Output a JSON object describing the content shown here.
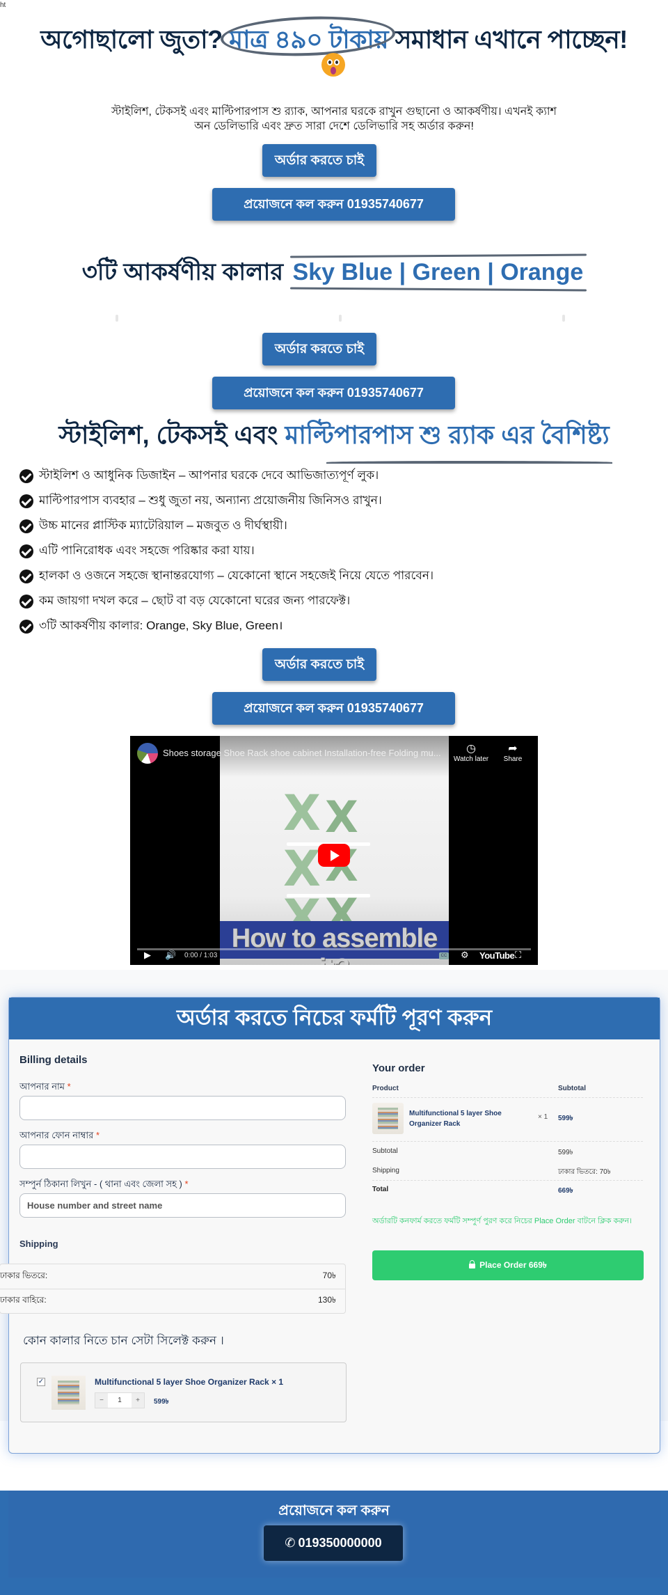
{
  "corner_text": "ht",
  "hero": {
    "title_before": "অগোছালো জুতা?",
    "title_highlight": "মাত্র ৪৯০ টাকায়",
    "title_after": "সমাধান এখানে পাচ্ছেন!",
    "emoji": "astonished-face",
    "lead": "স্টাইলিশ, টেকসই এবং মাল্টিপারপাস শু র‍্যাক, আপনার ঘরকে রাখুন গুছানো ও আকর্ষণীয়। এখনই ক্যাশ অন ডেলিভারি এবং দ্রুত সারা দেশে ডেলিভারি সহ অর্ডার করুন!"
  },
  "cta": {
    "order_label": "অর্ডার করতে চাই",
    "call_label": "প্রয়োজনে কল করুন 01935740677"
  },
  "colors_section": {
    "title_before": "৩টি আকর্ষণীয় কালার",
    "title_highlight": "Sky Blue | Green | Orange"
  },
  "features_section": {
    "title_before": "স্টাইলিশ, টেকসই এবং",
    "title_highlight": "মাল্টিপারপাস শু র‍্যাক এর বৈশিষ্ট্য",
    "items": [
      "স্টাইলিশ ও আধুনিক ডিজাইন – আপনার ঘরকে দেবে আভিজাত্যপূর্ণ লুক।",
      "মাল্টিপারপাস ব্যবহার – শুধু জুতা নয়, অন্যান্য প্রয়োজনীয় জিনিসও রাখুন।",
      "উচ্চ মানের প্লাস্টিক ম্যাটেরিয়াল – মজবুত ও দীর্ঘস্থায়ী।",
      "এটি পানিরোধক এবং সহজে পরিষ্কার করা যায়।",
      "হালকা ও ওজনে সহজে স্থানান্তরযোগ্য – যেকোনো স্থানে সহজেই নিয়ে যেতে পারবেন।",
      "কম জায়গা দখল করে – ছোট বা বড় যেকোনো ঘরের জন্য পারফেক্ট।",
      "৩টি আকর্ষণীয় কালার: Orange, Sky Blue, Green।"
    ]
  },
  "video": {
    "title": "Shoes storage Shoe Rack shoe cabinet Installation-free Folding mu...",
    "watch_later": "Watch later",
    "share": "Share",
    "overlay_text": "How to assemble it?",
    "time": "0:00 / 1:03",
    "brand": "YouTube",
    "cc": "CC"
  },
  "order_form": {
    "header": "অর্ডার করতে নিচের ফর্মটি পূরণ করুন",
    "billing_title": "Billing details",
    "fields": [
      {
        "label": "আপনার নাম",
        "required": "*",
        "value": "",
        "placeholder": ""
      },
      {
        "label": "আপনার ফোন নাম্বার",
        "required": "*",
        "value": "",
        "placeholder": ""
      },
      {
        "label": "সম্পুর্ন ঠিকানা লিখুন - ( থানা এবং জেলা সহ )",
        "required": "*",
        "value": "",
        "placeholder": "House number and street name"
      }
    ],
    "shipping_title": "Shipping",
    "shipping_options": [
      {
        "label": "ঢাকার ভিতরে:",
        "price": "70৳"
      },
      {
        "label": "ঢাকার বাহিরে:",
        "price": "130৳"
      }
    ],
    "color_select_title": "কোন কালার নিতে চান সেটা সিলেক্ট করুন ।",
    "product": {
      "checked": true,
      "name": "Multifunctional 5 layer Shoe Organizer Rack × 1",
      "quantity": "1",
      "minus": "−",
      "plus": "+",
      "price": "599৳"
    }
  },
  "your_order": {
    "title": "Your order",
    "col_product": "Product",
    "col_subtotal": "Subtotal",
    "item_name": "Multifunctional 5 layer Shoe Organizer Rack",
    "item_qty": "× 1",
    "item_subtotal": "599৳",
    "subtotal_label": "Subtotal",
    "subtotal_value": "599৳",
    "shipping_label": "Shipping",
    "shipping_value": "ঢাকার ভিতরে: 70৳",
    "total_label": "Total",
    "total_value": "669৳",
    "confirm_note": "অর্ডারটি কনফার্ম করতে ফর্মটি সম্পুর্ণ পুরণ করে নিচের Place Order বাটনে ক্লিক করুন।",
    "place_order_label": "Place Order  669৳"
  },
  "footer": {
    "title": "প্রয়োজনে কল করুন",
    "phone": "019350000000",
    "phone_icon": "phone-icon"
  },
  "colors": {
    "primary": "#2e6db1",
    "navy": "#0e2642",
    "success": "#2ecc71",
    "required": "#e2401c"
  }
}
